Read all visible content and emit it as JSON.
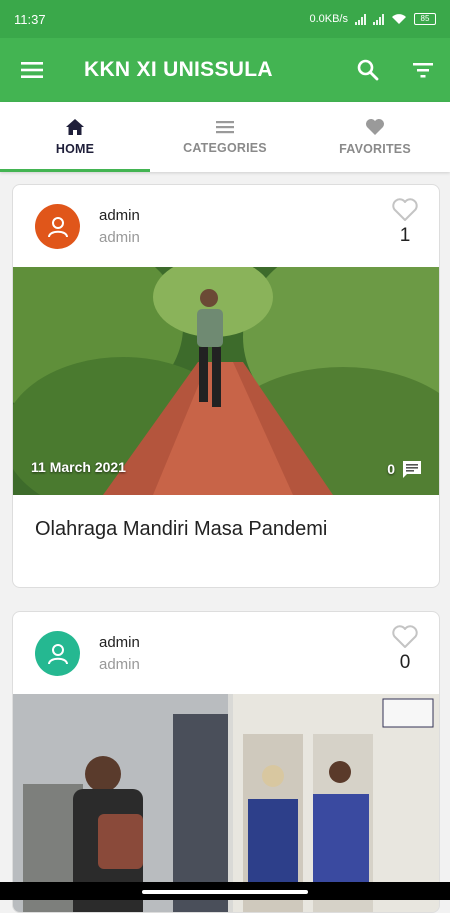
{
  "status_bar": {
    "time": "11:37",
    "network_speed": "0.0KB/s",
    "battery": "85"
  },
  "app_bar": {
    "title": "KKN XI UNISSULA"
  },
  "tabs": [
    {
      "label": "HOME",
      "icon": "home-icon",
      "active": true
    },
    {
      "label": "CATEGORIES",
      "icon": "list-icon",
      "active": false
    },
    {
      "label": "FAVORITES",
      "icon": "heart-icon",
      "active": false
    }
  ],
  "posts": [
    {
      "author": "admin",
      "author_sub": "admin",
      "avatar_color": "#e0561a",
      "likes": "1",
      "date": "11 March 2021",
      "comments": "0",
      "title": "Olahraga Mandiri Masa Pandemi"
    },
    {
      "author": "admin",
      "author_sub": "admin",
      "avatar_color": "#25b891",
      "likes": "0"
    }
  ],
  "colors": {
    "status_bar": "#3aa84a",
    "app_bar": "#43b452",
    "indicator": "#43b452"
  }
}
